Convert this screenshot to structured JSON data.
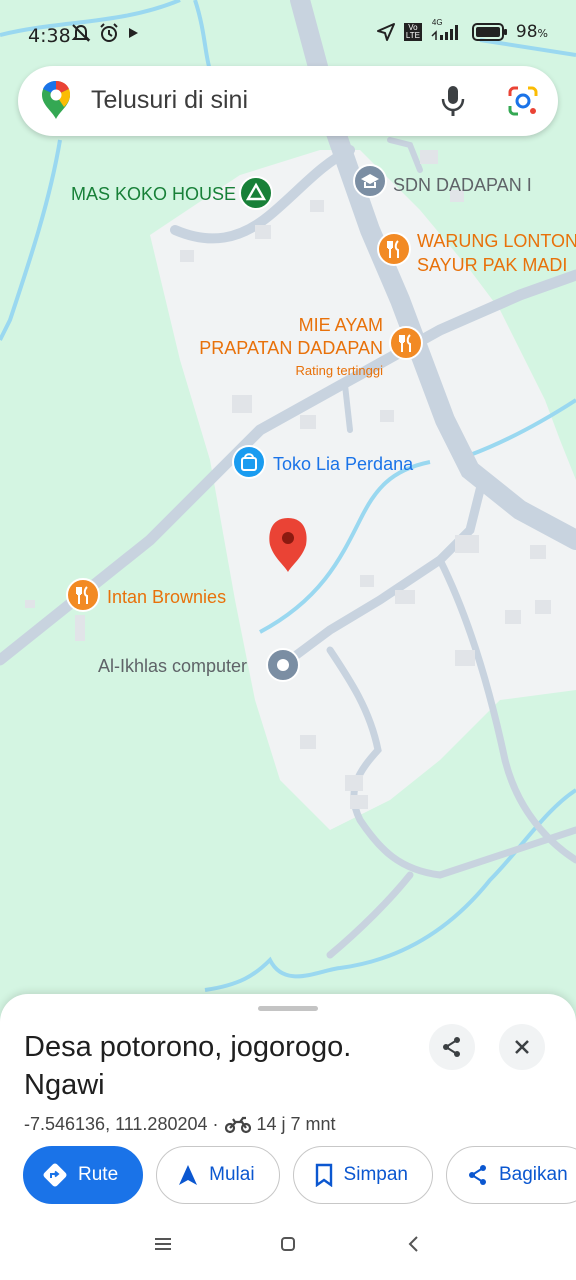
{
  "status": {
    "time": "4:38",
    "network_type": "4G",
    "volte": "Vo LTE",
    "battery": "98",
    "battery_unit": "%"
  },
  "search": {
    "placeholder": "Telusuri di sini"
  },
  "map": {
    "places": {
      "mas_koko": "MAS KOKO HOUSE",
      "sdn": "SDN DADAPAN I",
      "warung_line1": "WARUNG LONTONG",
      "warung_line2": "SAYUR PAK MADI",
      "mie_line1": "MIE AYAM",
      "mie_line2": "PRAPATAN DADAPAN",
      "mie_sub": "Rating tertinggi",
      "toko": "Toko Lia Perdana",
      "intan": "Intan Brownies",
      "alikhlas": "Al-Ikhlas computer"
    },
    "colors": {
      "land": "#d4f5e2",
      "urban": "#f1f3f4",
      "road": "#c8d3df",
      "water": "#9ad8f0",
      "pin": "#ea4335",
      "food": "#f28a24",
      "school": "#7b8ea3",
      "park": "#188038",
      "shop": "#1a9cf0"
    }
  },
  "sheet": {
    "title": "Desa potorono, jogorogo. Ngawi",
    "coords": "-7.546136, 111.280204 ·",
    "travel_time": "14 j 7 mnt",
    "actions": {
      "route": "Rute",
      "start": "Mulai",
      "save": "Simpan",
      "share": "Bagikan"
    }
  }
}
